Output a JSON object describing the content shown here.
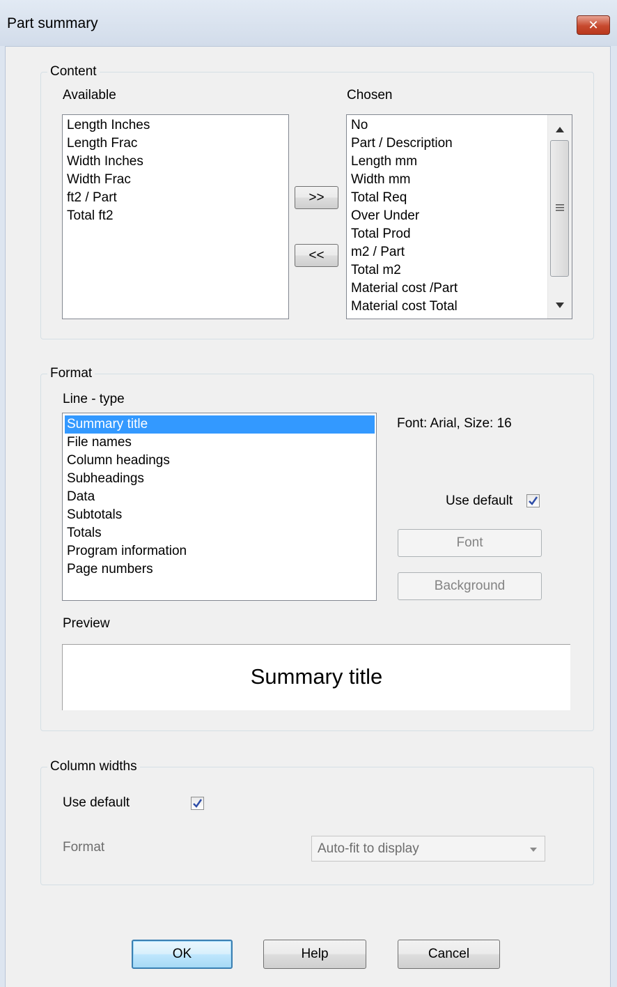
{
  "window": {
    "title": "Part summary",
    "close_glyph": "✕"
  },
  "content": {
    "legend": "Content",
    "available_label": "Available",
    "chosen_label": "Chosen",
    "available_items": [
      "Length Inches",
      "Length Frac",
      "Width Inches",
      "Width Frac",
      "ft2 / Part",
      "Total ft2"
    ],
    "chosen_items": [
      "No",
      "Part / Description",
      "Length mm",
      "Width mm",
      "Total Req",
      "Over Under",
      "Total Prod",
      "m2 / Part",
      "Total m2",
      "Material cost /Part",
      "Material cost Total"
    ],
    "add_button": ">>",
    "remove_button": "<<"
  },
  "format": {
    "legend": "Format",
    "line_type_label": "Line - type",
    "line_types": [
      "Summary title",
      "File names",
      "Column headings",
      "Subheadings",
      "Data",
      "Subtotals",
      "Totals",
      "Program information",
      "Page numbers"
    ],
    "selected_index": 0,
    "font_info": "Font: Arial, Size: 16",
    "use_default_label": "Use default",
    "use_default_checked": true,
    "font_button": "Font",
    "background_button": "Background",
    "preview_label": "Preview",
    "preview_text": "Summary title"
  },
  "column_widths": {
    "legend": "Column widths",
    "use_default_label": "Use default",
    "use_default_checked": true,
    "format_label": "Format",
    "format_value": "Auto-fit to display"
  },
  "buttons": {
    "ok": "OK",
    "help": "Help",
    "cancel": "Cancel"
  },
  "colors": {
    "selection": "#3399ff",
    "checkmark": "#2f4ea8",
    "close_button": "#c7492e"
  }
}
